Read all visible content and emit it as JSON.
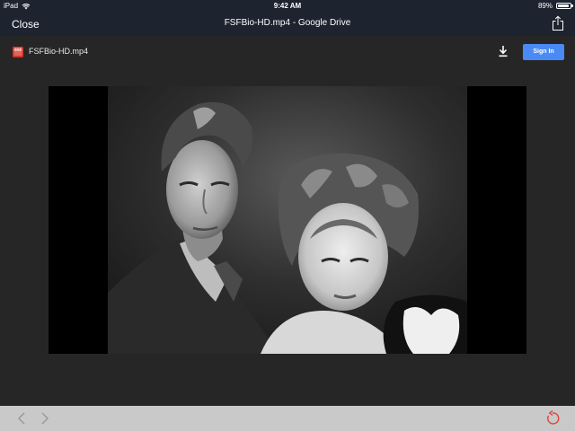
{
  "status_bar": {
    "device": "iPad",
    "time": "9:42 AM",
    "battery": "89%",
    "battery_level": 0.89
  },
  "nav_bar": {
    "close_label": "Close",
    "title": "FSFBio-HD.mp4 - Google Drive"
  },
  "file_bar": {
    "file_name": "FSFBio-HD.mp4",
    "sign_in_label": "Sign In"
  },
  "colors": {
    "nav_background": "#1d2430",
    "page_background": "#262626",
    "accent": "#4a8af4",
    "file_icon": "#d93025",
    "toolbar_background": "#c9c9c9",
    "refresh_icon": "#e0443a"
  },
  "icons": {
    "wifi": "wifi-icon",
    "battery": "battery-icon",
    "share": "share-icon",
    "file": "video-file-icon",
    "download": "download-icon",
    "back": "chevron-left-icon",
    "forward": "chevron-right-icon",
    "refresh": "refresh-icon"
  }
}
